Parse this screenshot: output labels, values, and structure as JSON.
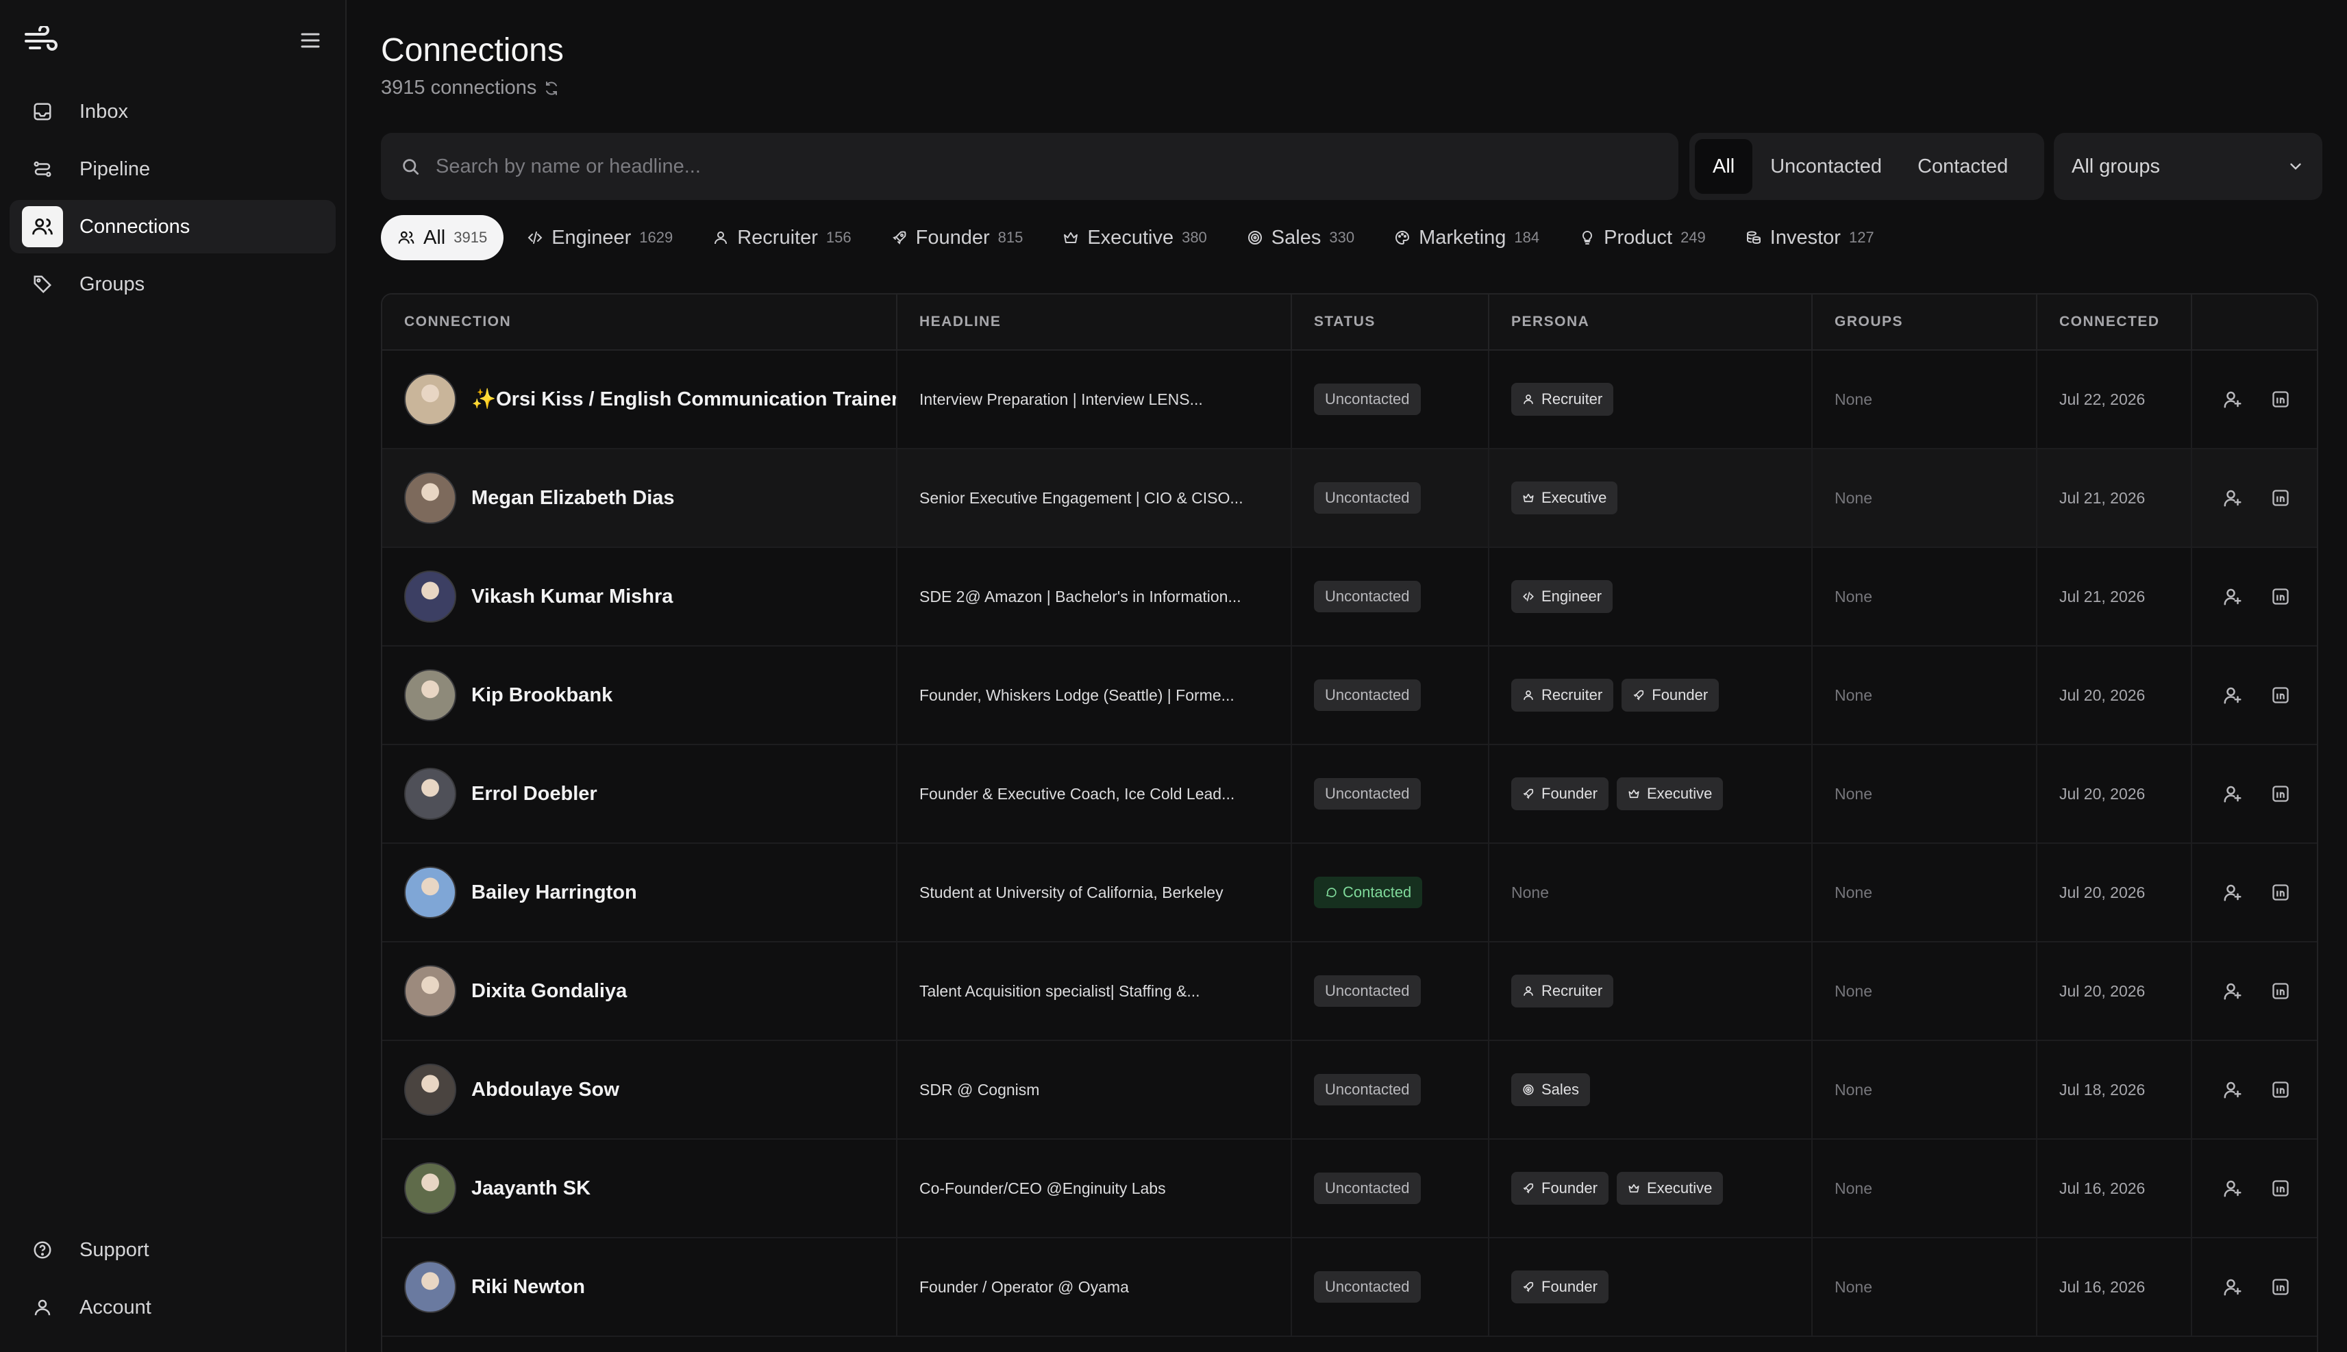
{
  "sidebar": {
    "nav": [
      {
        "label": "Inbox",
        "icon": "inbox-icon"
      },
      {
        "label": "Pipeline",
        "icon": "pipeline-icon"
      },
      {
        "label": "Connections",
        "icon": "users-icon"
      },
      {
        "label": "Groups",
        "icon": "tag-icon"
      }
    ],
    "bottom": [
      {
        "label": "Support",
        "icon": "help-circle-icon"
      },
      {
        "label": "Account",
        "icon": "user-icon"
      }
    ]
  },
  "header": {
    "title": "Connections",
    "subtitle": "3915 connections"
  },
  "search": {
    "placeholder": "Search by name or headline..."
  },
  "status_filter": {
    "options": [
      "All",
      "Uncontacted",
      "Contacted"
    ],
    "active": "All"
  },
  "groups_select": {
    "value": "All groups"
  },
  "persona_chips": [
    {
      "label": "All",
      "count": "3915",
      "icon": "users-icon"
    },
    {
      "label": "Engineer",
      "count": "1629",
      "icon": "code-icon"
    },
    {
      "label": "Recruiter",
      "count": "156",
      "icon": "user-icon"
    },
    {
      "label": "Founder",
      "count": "815",
      "icon": "rocket-icon"
    },
    {
      "label": "Executive",
      "count": "380",
      "icon": "crown-icon"
    },
    {
      "label": "Sales",
      "count": "330",
      "icon": "target-icon"
    },
    {
      "label": "Marketing",
      "count": "184",
      "icon": "palette-icon"
    },
    {
      "label": "Product",
      "count": "249",
      "icon": "lightbulb-icon"
    },
    {
      "label": "Investor",
      "count": "127",
      "icon": "coins-icon"
    }
  ],
  "table": {
    "columns": [
      "CONNECTION",
      "HEADLINE",
      "STATUS",
      "PERSONA",
      "GROUPS",
      "CONNECTED"
    ],
    "rows": [
      {
        "name": "✨Orsi Kiss / English Communication Trainer",
        "headline": "Interview Preparation | Interview LENS...",
        "status": "Uncontacted",
        "personas": [
          "Recruiter"
        ],
        "groups": "None",
        "connected": "Jul 22, 2026",
        "avatar_color": "#c9b59a"
      },
      {
        "name": "Megan Elizabeth Dias",
        "headline": "Senior Executive Engagement | CIO & CISO...",
        "status": "Uncontacted",
        "personas": [
          "Executive"
        ],
        "groups": "None",
        "connected": "Jul 21, 2026",
        "avatar_color": "#7d6a5c"
      },
      {
        "name": "Vikash Kumar Mishra",
        "headline": "SDE 2@ Amazon | Bachelor's in Information...",
        "status": "Uncontacted",
        "personas": [
          "Engineer"
        ],
        "groups": "None",
        "connected": "Jul 21, 2026",
        "avatar_color": "#3c3f63"
      },
      {
        "name": "Kip Brookbank",
        "headline": "Founder, Whiskers Lodge (Seattle) | Forme...",
        "status": "Uncontacted",
        "personas": [
          "Recruiter",
          "Founder"
        ],
        "groups": "None",
        "connected": "Jul 20, 2026",
        "avatar_color": "#8e8a7a"
      },
      {
        "name": "Errol Doebler",
        "headline": "Founder & Executive Coach, Ice Cold Lead...",
        "status": "Uncontacted",
        "personas": [
          "Founder",
          "Executive"
        ],
        "groups": "None",
        "connected": "Jul 20, 2026",
        "avatar_color": "#4f5058"
      },
      {
        "name": "Bailey Harrington",
        "headline": "Student at University of California, Berkeley",
        "status": "Contacted",
        "personas": [],
        "personas_empty": "None",
        "groups": "None",
        "connected": "Jul 20, 2026",
        "avatar_color": "#7fa6d6"
      },
      {
        "name": "Dixita Gondaliya",
        "headline": "Talent Acquisition specialist| Staffing &...",
        "status": "Uncontacted",
        "personas": [
          "Recruiter"
        ],
        "groups": "None",
        "connected": "Jul 20, 2026",
        "avatar_color": "#9c8a7d"
      },
      {
        "name": "Abdoulaye Sow",
        "headline": "SDR @ Cognism",
        "status": "Uncontacted",
        "personas": [
          "Sales"
        ],
        "groups": "None",
        "connected": "Jul 18, 2026",
        "avatar_color": "#4a4440"
      },
      {
        "name": "Jaayanth SK",
        "headline": "Co-Founder/CEO @Enginuity Labs",
        "status": "Uncontacted",
        "personas": [
          "Founder",
          "Executive"
        ],
        "groups": "None",
        "connected": "Jul 16, 2026",
        "avatar_color": "#5f6b4a"
      },
      {
        "name": "Riki Newton",
        "headline": "Founder / Operator @ Oyama",
        "status": "Uncontacted",
        "personas": [
          "Founder"
        ],
        "groups": "None",
        "connected": "Jul 16, 2026",
        "avatar_color": "#6a7aa0"
      }
    ]
  }
}
